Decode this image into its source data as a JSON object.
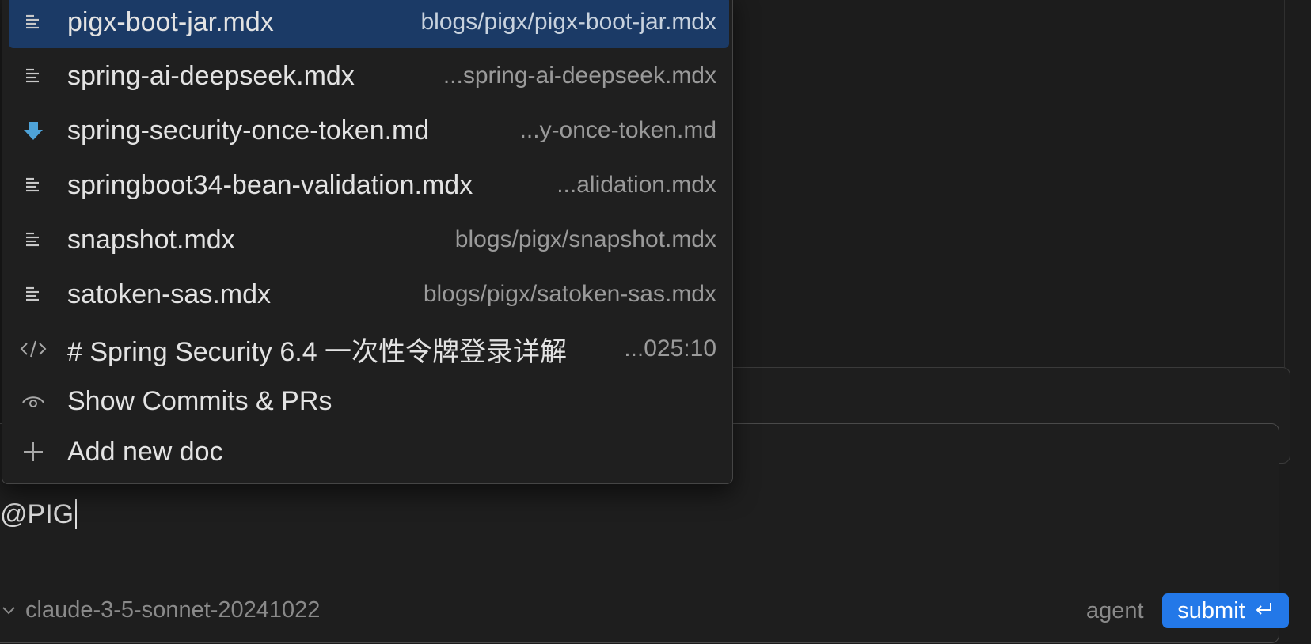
{
  "popup": {
    "items": [
      {
        "icon": "doc-lines-icon",
        "name": "pigx-boot-jar.mdx",
        "path": "blogs/pigx/pigx-boot-jar.mdx",
        "selected": true
      },
      {
        "icon": "doc-lines-icon",
        "name": "spring-ai-deepseek.mdx",
        "path": "...spring-ai-deepseek.mdx"
      },
      {
        "icon": "markdown-arrow-icon",
        "name": "spring-security-once-token.md",
        "path": "...y-once-token.md"
      },
      {
        "icon": "doc-lines-icon",
        "name": "springboot34-bean-validation.mdx",
        "path": "...alidation.mdx"
      },
      {
        "icon": "doc-lines-icon",
        "name": "snapshot.mdx",
        "path": "blogs/pigx/snapshot.mdx"
      },
      {
        "icon": "doc-lines-icon",
        "name": "satoken-sas.mdx",
        "path": "blogs/pigx/satoken-sas.mdx"
      },
      {
        "icon": "code-icon",
        "name": "# Spring Security 6.4 一次性令牌登录详解",
        "path": "...025:10"
      },
      {
        "icon": "eye-icon",
        "name": "Show Commits & PRs",
        "path": ""
      },
      {
        "icon": "plus-icon",
        "name": "Add new doc",
        "path": ""
      }
    ]
  },
  "composer": {
    "input_value": "@PIG",
    "model": "claude-3-5-sonnet-20241022",
    "mode": "agent",
    "submit_label": "submit"
  },
  "colors": {
    "selected_bg": "#1b3a66",
    "submit_bg": "#2378e8",
    "markdown_icon": "#4ea3d8"
  }
}
